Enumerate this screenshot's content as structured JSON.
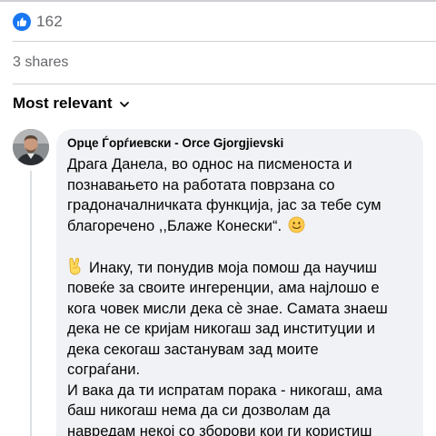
{
  "reactions": {
    "icon": "like-icon",
    "count": "162",
    "color": "#1877f2"
  },
  "shares": {
    "text": "3 shares"
  },
  "sort": {
    "label": "Most relevant",
    "icon": "chevron-down-icon"
  },
  "comment": {
    "author": "Орце Ѓорѓиевски - Orce Gjorgjievski",
    "lines": [
      "Драга Данела, во однос на писменоста и",
      "познавањето на работата поврзана со",
      "градоначалничката функција, јас за тебе сум",
      "благоречено ,,Блаже Конески“.",
      "",
      "Инаку, ти понудив моја помош да научиш",
      "повеќе за своите ингеренции, ама најлошо е",
      "кога човек мисли дека сѐ знае. Самата знаеш",
      "дека не се кријам никогаш зад институции и",
      "дека секогаш застанувам зад моите",
      "сограѓани.",
      "И вака да ти испратам порака - никогаш, ама",
      "баш никогаш нема да си дозволам да",
      "навредам некој со зборови кои ги користиш"
    ],
    "emoji_after_line_4": "smiling-face-emoji",
    "emoji_before_line_6": "victory-hand-emoji"
  }
}
